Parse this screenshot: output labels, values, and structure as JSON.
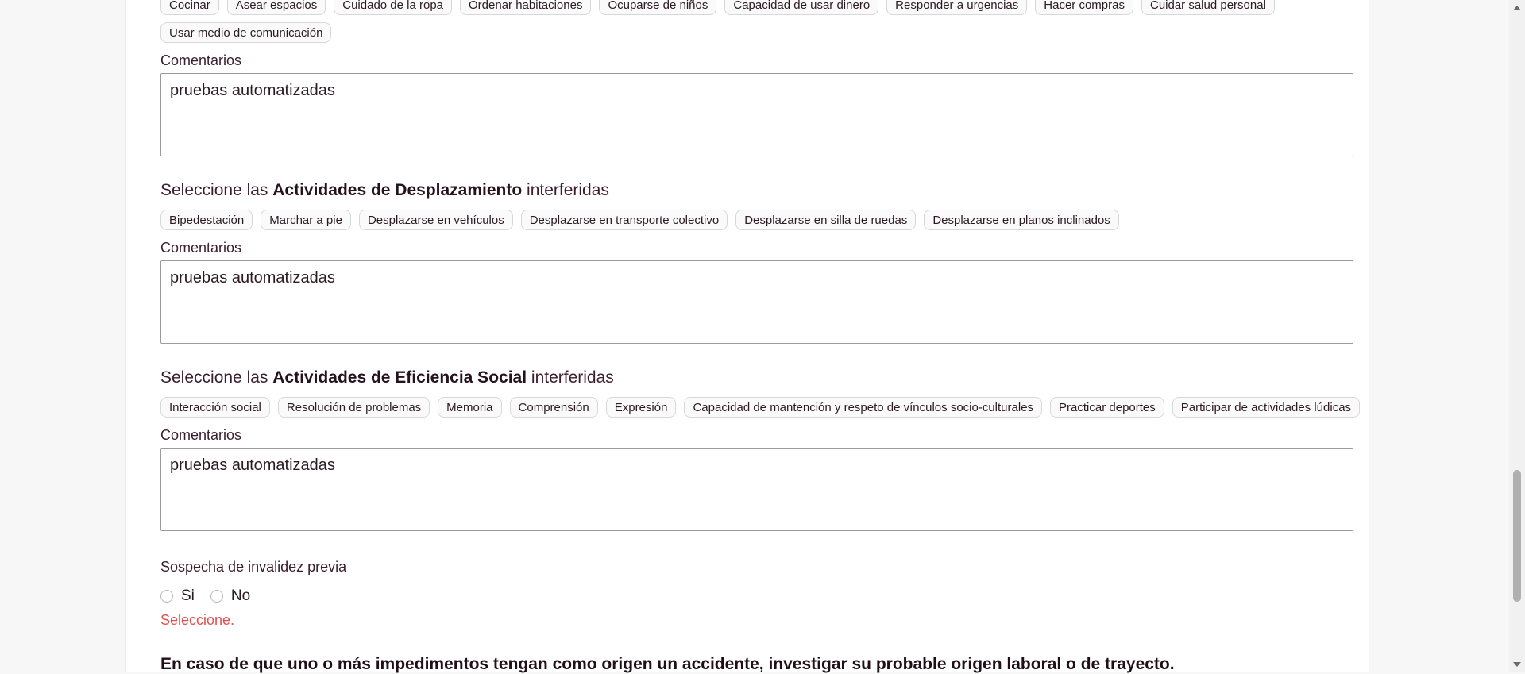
{
  "domestic": {
    "chips_row1": [
      "Cocinar",
      "Asear espacios",
      "Cuidado de la ropa",
      "Ordenar habitaciones",
      "Ocuparse de niños",
      "Capacidad de usar dinero",
      "Responder a urgencias",
      "Hacer compras",
      "Cuidar salud personal"
    ],
    "chips_row2": [
      "Usar medio de comunicación"
    ],
    "comments_label": "Comentarios",
    "comments_value": "pruebas automatizadas"
  },
  "displacement": {
    "heading_pre": "Seleccione las ",
    "heading_bold": "Actividades de Desplazamiento",
    "heading_post": " interferidas",
    "chips": [
      "Bipedestación",
      "Marchar a pie",
      "Desplazarse en vehículos",
      "Desplazarse en transporte colectivo",
      "Desplazarse en silla de ruedas",
      "Desplazarse en planos inclinados"
    ],
    "comments_label": "Comentarios",
    "comments_value": "pruebas automatizadas"
  },
  "social": {
    "heading_pre": "Seleccione las ",
    "heading_bold": "Actividades de Eficiencia Social",
    "heading_post": " interferidas",
    "chips": [
      "Interacción social",
      "Resolución de problemas",
      "Memoria",
      "Comprensión",
      "Expresión",
      "Capacidad de mantención y respeto de vínculos socio-culturales",
      "Practicar deportes",
      "Participar de actividades lúdicas"
    ],
    "comments_label": "Comentarios",
    "comments_value": "pruebas automatizadas"
  },
  "invalidity": {
    "label": "Sospecha de invalidez previa",
    "options": [
      "Si",
      "No"
    ],
    "error": "Seleccione."
  },
  "notice": "En caso de que uno o más impedimentos tengan como origen un accidente, investigar su probable origen laboral o de trayecto."
}
